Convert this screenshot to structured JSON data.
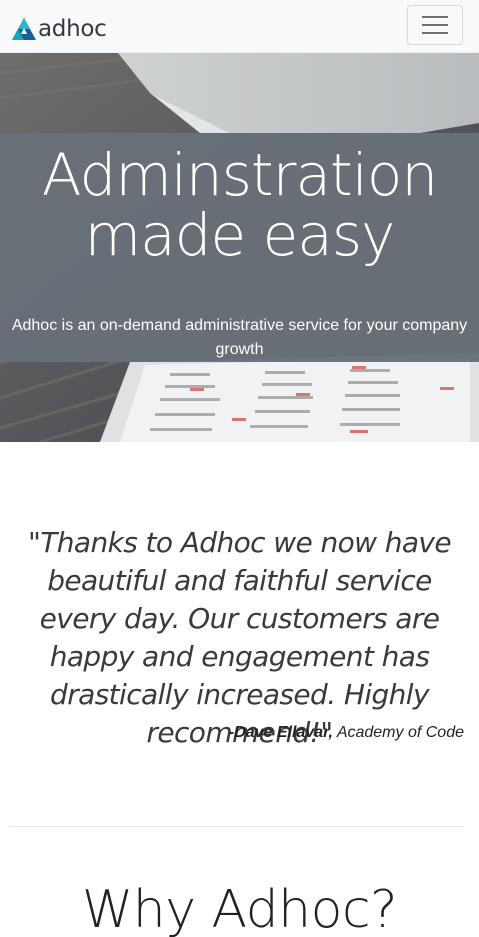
{
  "navbar": {
    "brand_text": "adhoc",
    "brand_colors": [
      "#1aa3b5",
      "#1b5e9e"
    ],
    "toggler_icon": "hamburger-menu-icon"
  },
  "hero": {
    "title_line1": "Adminstration",
    "title_line2": "made easy",
    "subtitle": "Adhoc is an on-demand administrative service for your company growth"
  },
  "testimonial": {
    "quote": "\"Thanks to Adhoc we now have beautiful and faithful service every day. Our customers are happy and engagement has drastically increased. Highly recommend!\"",
    "author": "-Dave Ellavar,",
    "company": "Academy of Code"
  },
  "section": {
    "title": "Why Adhoc?"
  }
}
